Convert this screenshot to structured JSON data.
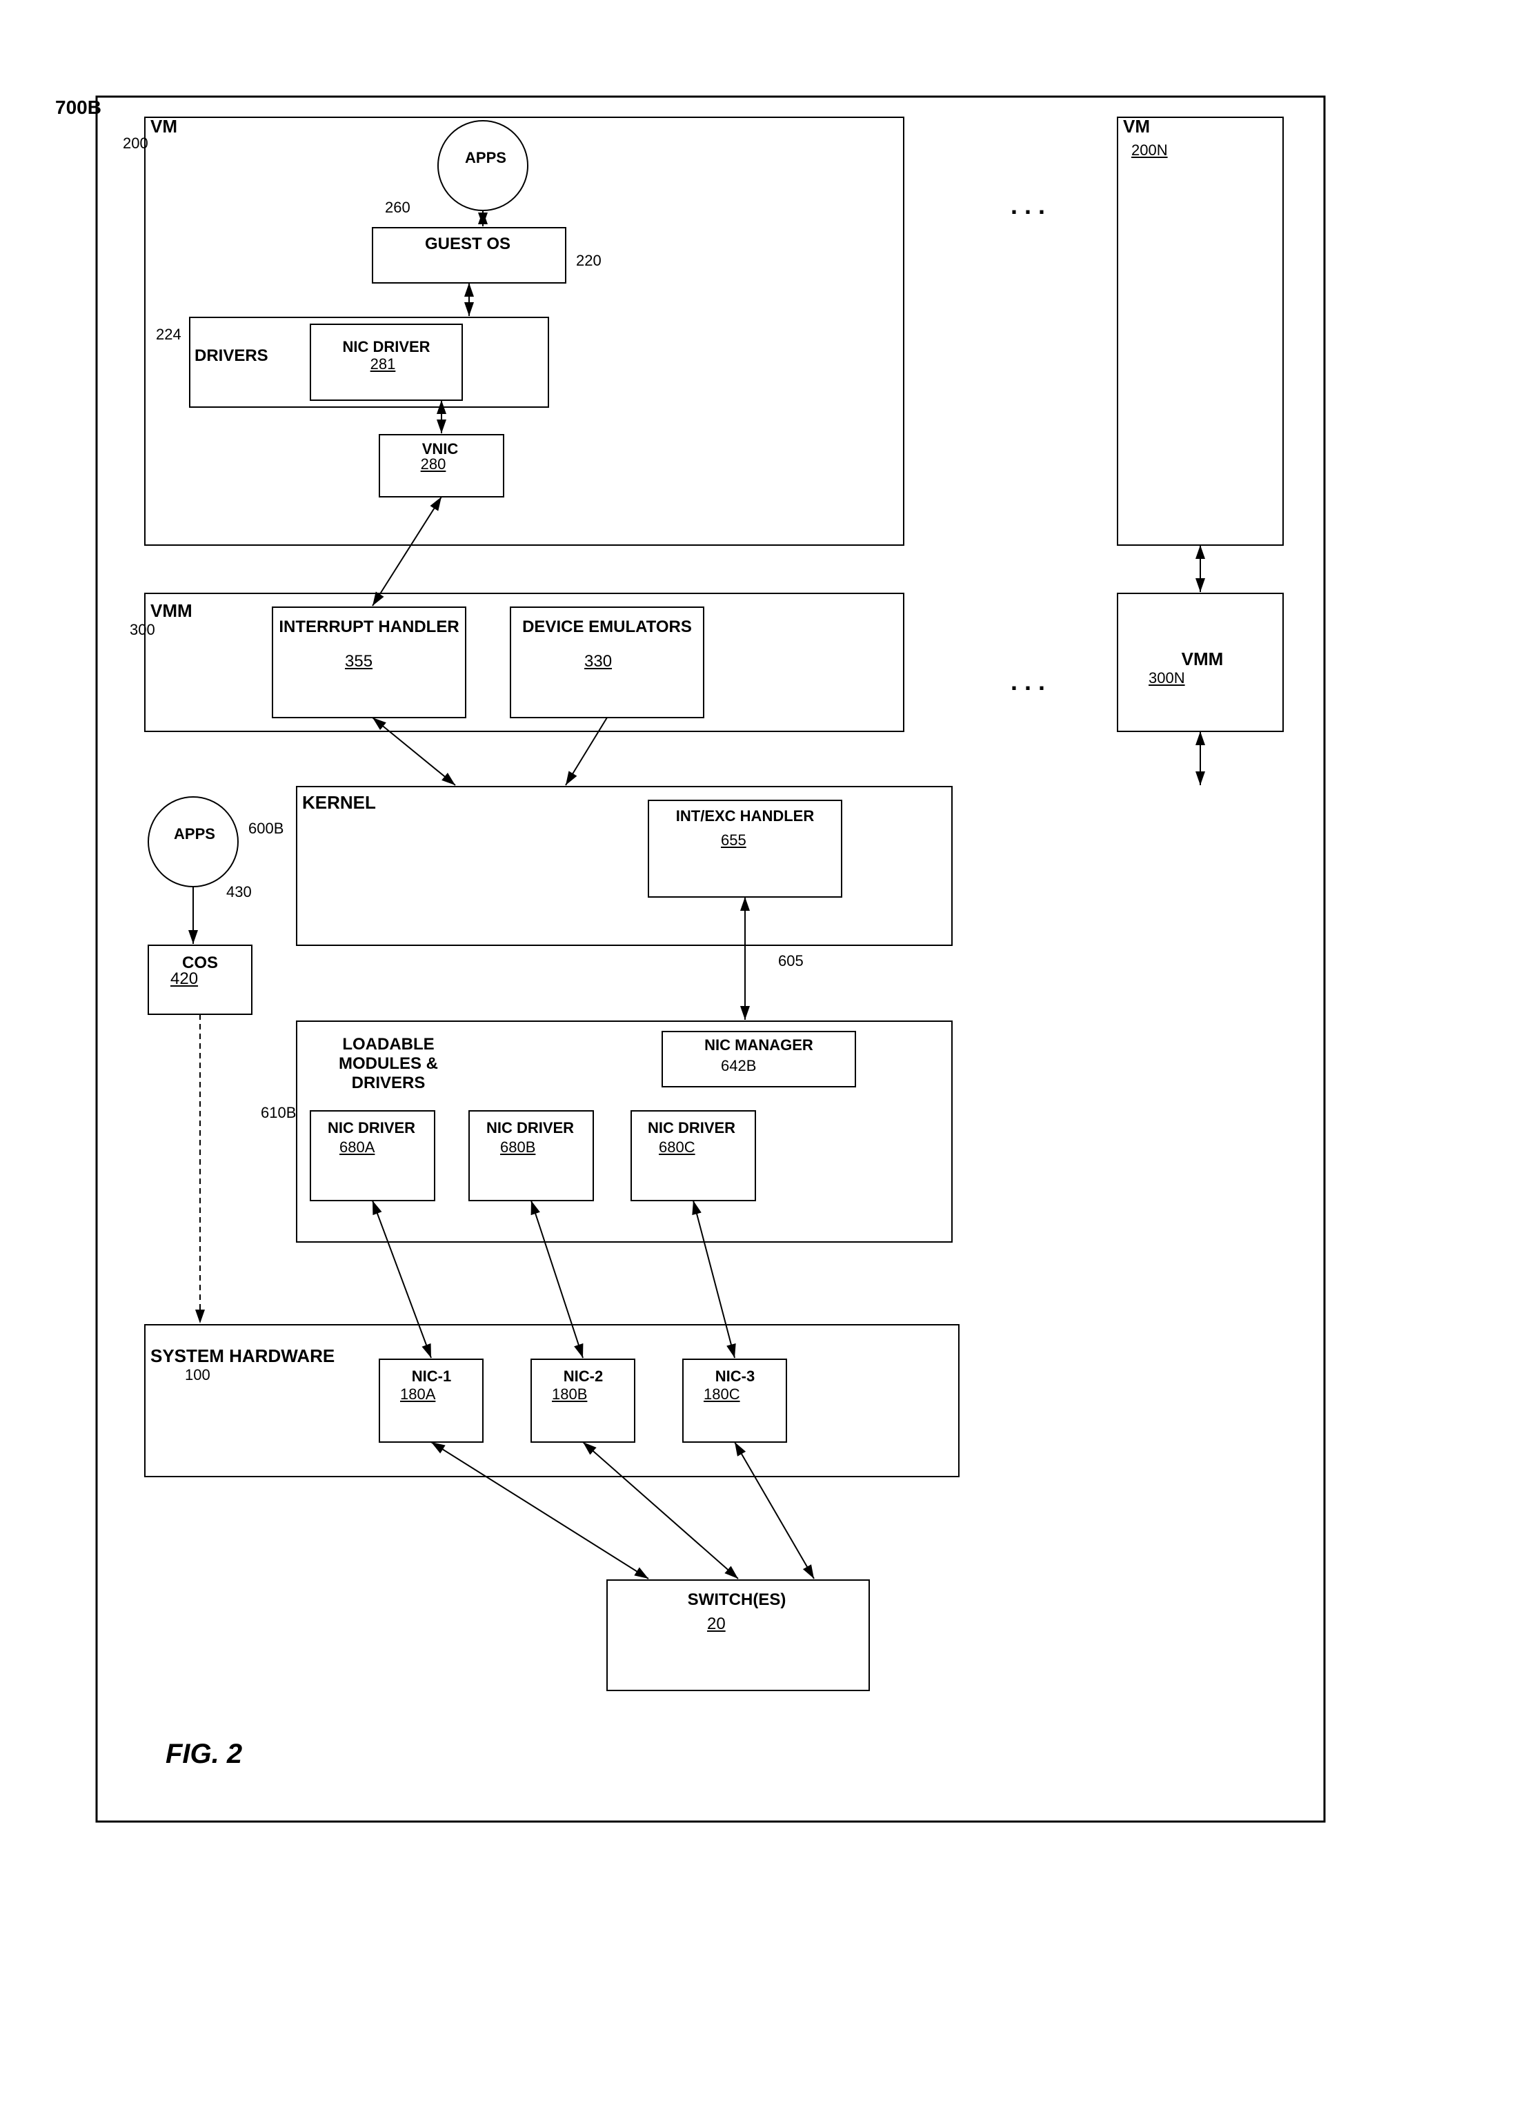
{
  "title": "FIG. 2",
  "components": {
    "outer_box_label": "700B",
    "vm_main": {
      "label": "VM",
      "ref": "200"
    },
    "vm_n": {
      "label": "VM",
      "ref": "200N"
    },
    "apps_top": {
      "label": "APPS",
      "ref": "260"
    },
    "guest_os": {
      "label": "GUEST OS",
      "ref": "220"
    },
    "drivers": {
      "label": "DRIVERS",
      "ref": "224"
    },
    "nic_driver_top": {
      "label": "NIC DRIVER",
      "ref": "281"
    },
    "vnic": {
      "label": "VNIC",
      "ref": "280"
    },
    "vmm_main": {
      "label": "VMM",
      "ref": "300"
    },
    "vmm_n": {
      "label": "VMM",
      "ref": "300N"
    },
    "interrupt_handler": {
      "label": "INTERRUPT HANDLER",
      "ref": "355"
    },
    "device_emulators": {
      "label": "DEVICE EMULATORS",
      "ref": "330"
    },
    "kernel": {
      "label": "KERNEL",
      "ref": "600B"
    },
    "int_exc_handler": {
      "label": "INT/EXC HANDLER",
      "ref": "655"
    },
    "apps_left": {
      "label": "APPS",
      "ref": "430"
    },
    "cos": {
      "label": "COS",
      "ref": "420"
    },
    "loadable_modules": {
      "label": "LOADABLE MODULES & DRIVERS",
      "ref": "610B"
    },
    "nic_manager": {
      "label": "NIC MANAGER",
      "ref": "642B"
    },
    "nic_driver_a": {
      "label": "NIC DRIVER",
      "ref": "680A"
    },
    "nic_driver_b": {
      "label": "NIC DRIVER",
      "ref": "680B"
    },
    "nic_driver_c": {
      "label": "NIC DRIVER",
      "ref": "680C"
    },
    "system_hardware": {
      "label": "SYSTEM HARDWARE",
      "ref": "100"
    },
    "nic_1": {
      "label": "NIC-1",
      "ref": "180A"
    },
    "nic_2": {
      "label": "NIC-2",
      "ref": "180B"
    },
    "nic_3": {
      "label": "NIC-3",
      "ref": "180C"
    },
    "switches": {
      "label": "SWITCH(ES)",
      "ref": "20"
    },
    "ref_605": "605",
    "fig_label": "FIG. 2"
  }
}
